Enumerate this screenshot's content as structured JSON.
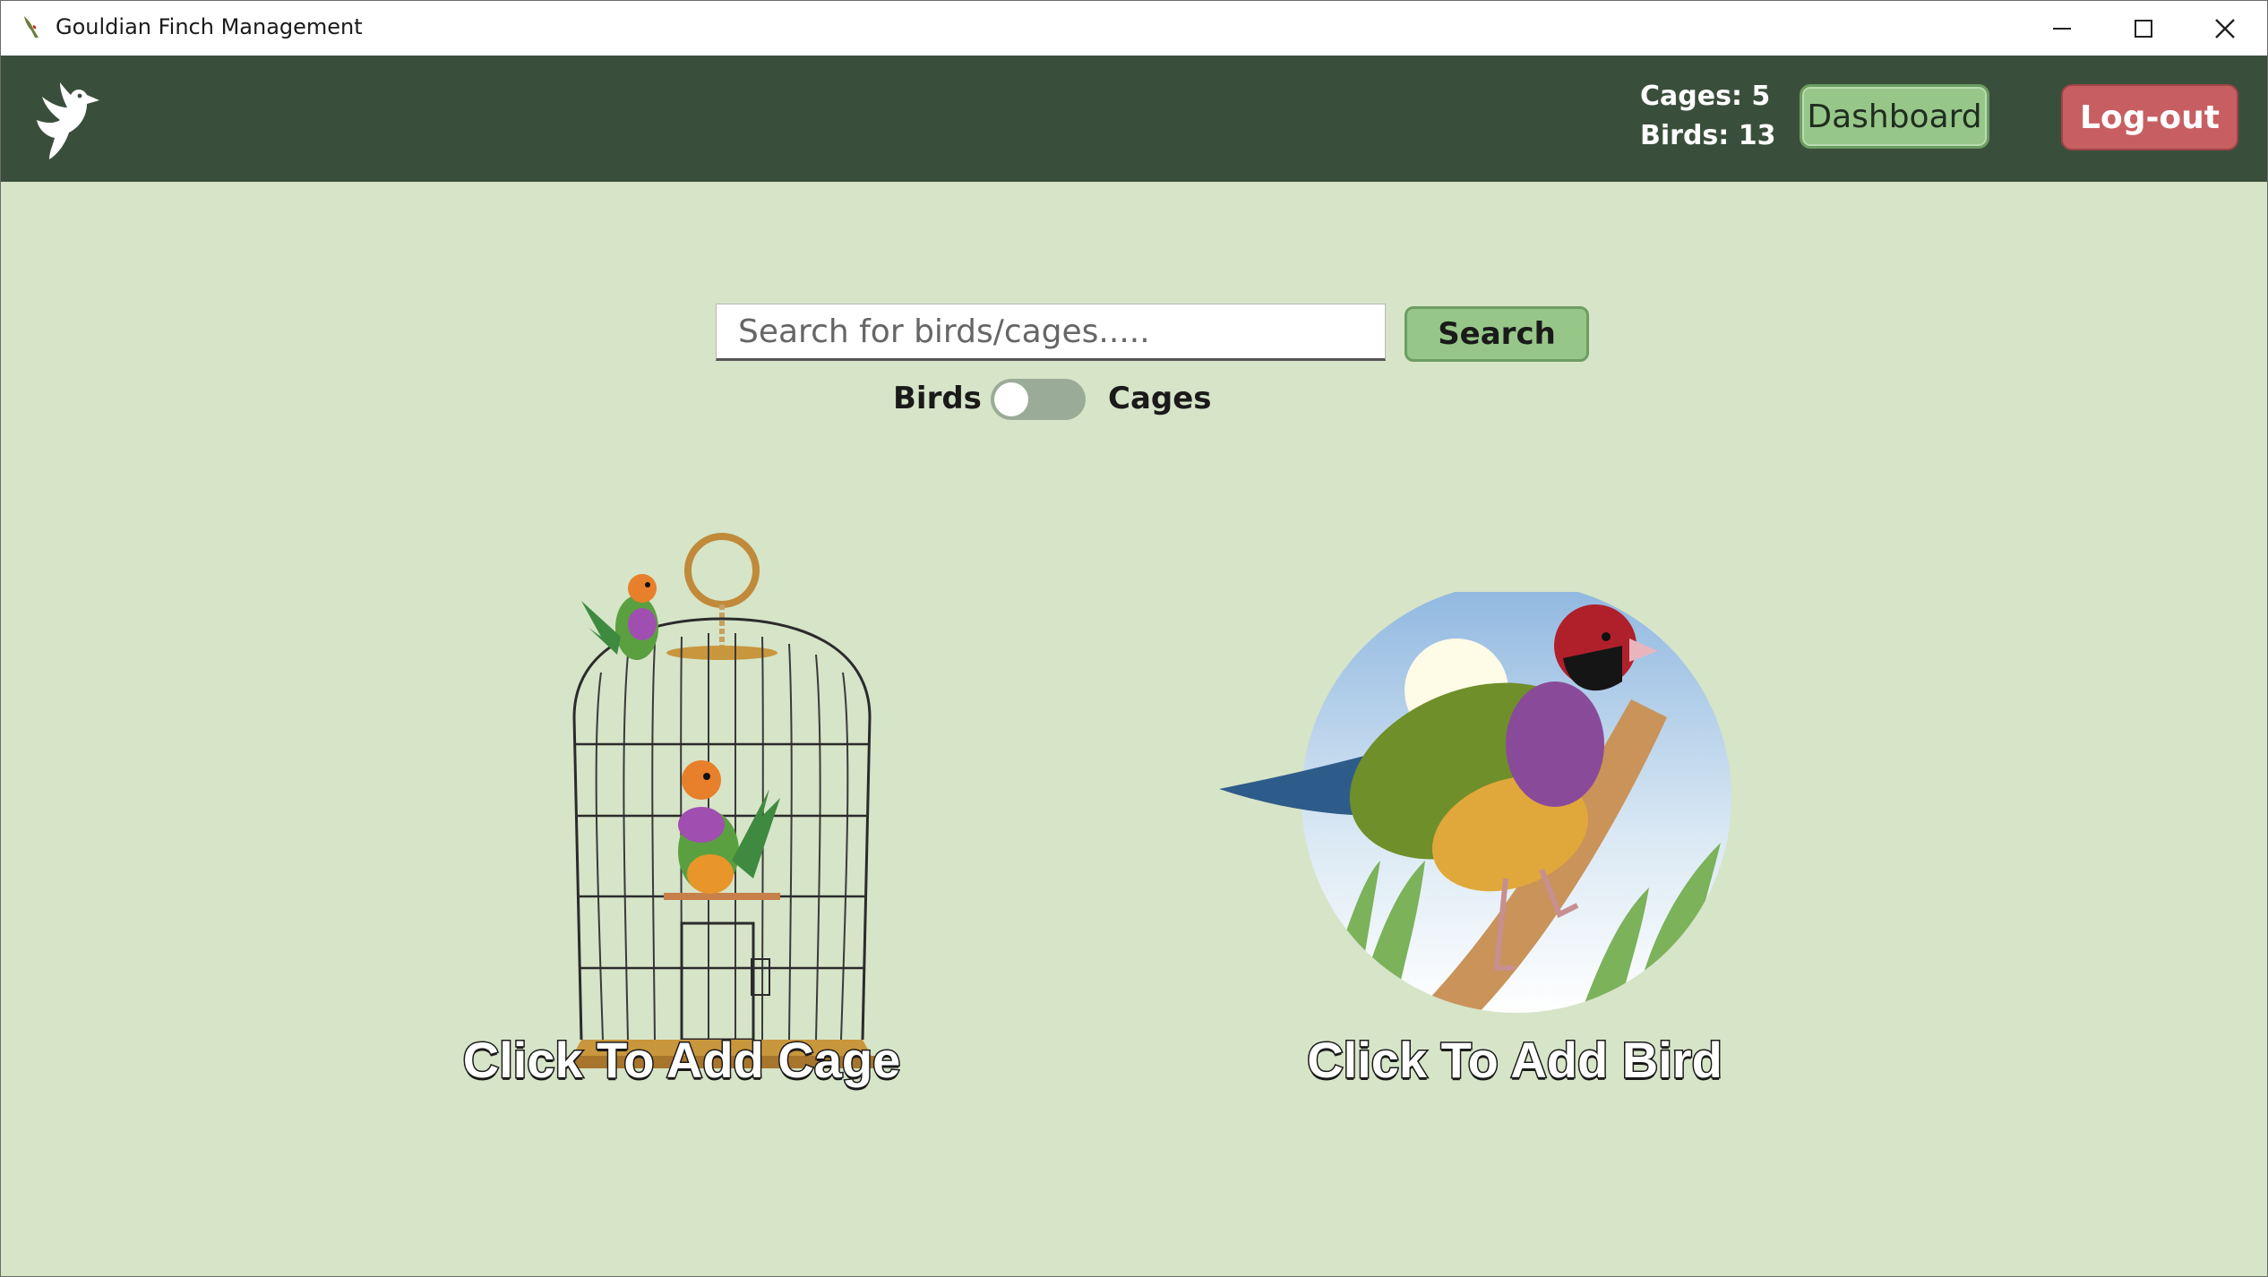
{
  "window": {
    "title": "Gouldian Finch Management"
  },
  "header": {
    "stats": {
      "cages": "Cages: 5",
      "birds": "Birds: 13"
    },
    "dashboard_label": "Dashboard",
    "logout_label": "Log-out"
  },
  "search": {
    "placeholder": "Search for birds/cages.....",
    "button_label": "Search",
    "toggle": {
      "left_label": "Birds",
      "right_label": "Cages",
      "state": "off"
    }
  },
  "actions": {
    "add_cage_label": "Click To Add Cage",
    "add_bird_label": "Click To Add Bird"
  },
  "colors": {
    "background": "#d6e4c8",
    "header": "#3a4f3b",
    "accent_green": "#97c689",
    "logout_red": "#c75f62",
    "toggle_track": "#9aac97"
  }
}
